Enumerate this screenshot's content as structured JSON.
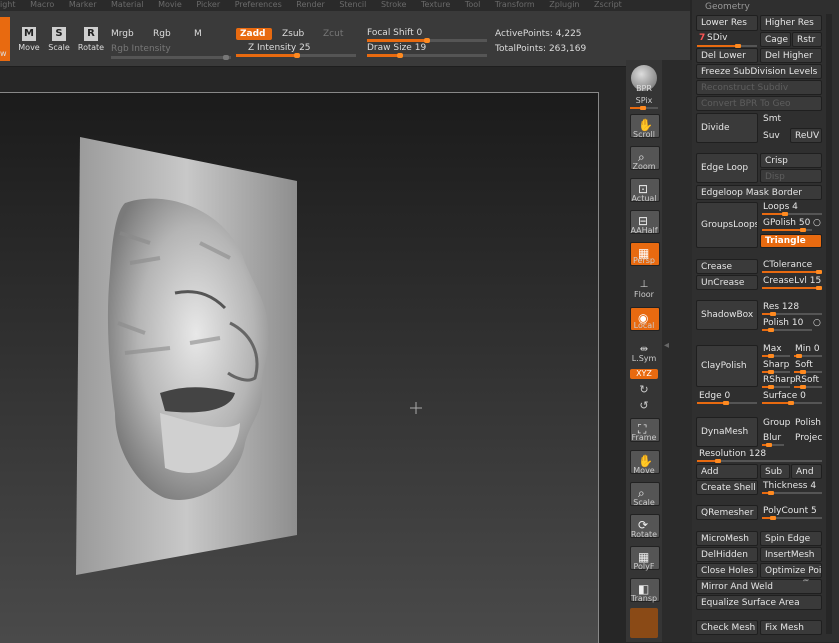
{
  "menu": [
    "ight",
    "Macro",
    "Marker",
    "Material",
    "Movie",
    "Picker",
    "Preferences",
    "Render",
    "Stencil",
    "Stroke",
    "Texture",
    "Tool",
    "Transform",
    "Zplugin",
    "Zscript"
  ],
  "transform_tools": [
    {
      "label": "w",
      "icon": "draw-icon",
      "active": true
    },
    {
      "label": "Move",
      "icon": "M",
      "active": false
    },
    {
      "label": "Scale",
      "icon": "S",
      "active": false
    },
    {
      "label": "Rotate",
      "icon": "R",
      "active": false
    }
  ],
  "topbar": {
    "mrgb": "Mrgb",
    "rgb": "Rgb",
    "m": "M",
    "rgb_intensity": "Rgb Intensity",
    "zadd": "Zadd",
    "zsub": "Zsub",
    "zcut": "Zcut",
    "z_intensity_label": "Z Intensity",
    "z_intensity_value": "25",
    "focal_shift_label": "Focal Shift",
    "focal_shift_value": "0",
    "draw_size_label": "Draw Size",
    "draw_size_value": "19",
    "active_points": "ActivePoints: 4,225",
    "total_points": "TotalPoints: 263,169"
  },
  "shelf": {
    "bpr": "BPR",
    "spix": "SPix",
    "scroll": "Scroll",
    "zoom": "Zoom",
    "actual": "Actual",
    "aahalf": "AAHalf",
    "persp": "Persp",
    "floor": "Floor",
    "local": "Local",
    "lsym": "L.Sym",
    "xyz": "XYZ",
    "frame": "Frame",
    "move": "Move",
    "scale": "Scale",
    "rotate": "Rotate",
    "polyf": "PolyF",
    "transp": "Transp"
  },
  "geometry": {
    "title": "Geometry",
    "lower_res": "Lower Res",
    "higher_res": "Higher Res",
    "sdiv_value": "7",
    "sdiv_label": "SDiv",
    "cage": "Cage",
    "rstr": "Rstr",
    "del_lower": "Del Lower",
    "del_higher": "Del Higher",
    "freeze": "Freeze SubDivision Levels",
    "reconstruct": "Reconstruct Subdiv",
    "convert_bpr": "Convert BPR To Geo",
    "divide": "Divide",
    "smt": "Smt",
    "suv": "Suv",
    "reuv": "ReUV",
    "edge_loop": "Edge Loop",
    "crisp": "Crisp",
    "disp": "Disp",
    "edgeloop_mask": "Edgeloop Mask Border",
    "groupsloops": "GroupsLoops",
    "loops": "Loops 4",
    "gpolish": "GPolish 50",
    "triangle": "Triangle",
    "crease": "Crease",
    "ctolerance": "CTolerance",
    "uncrease": "UnCrease",
    "creaselvl": "CreaseLvl 15",
    "shadowbox": "ShadowBox",
    "res": "Res 128",
    "polish": "Polish 10",
    "claypolish": "ClayPolish",
    "max": "Max",
    "min": "Min 0",
    "sharp": "Sharp",
    "soft": "Soft",
    "rsharp": "RSharp",
    "rsoft": "RSoft",
    "edge": "Edge 0",
    "surface": "Surface 0",
    "dynamesh": "DynaMesh",
    "group": "Group",
    "polish2": "Polish",
    "blur": "Blur",
    "project": "Projec",
    "resolution": "Resolution 128",
    "add": "Add",
    "sub": "Sub",
    "and": "And",
    "create_shell": "Create Shell",
    "thickness": "Thickness 4",
    "qremesher": "QRemesher",
    "polycount": "PolyCount 5",
    "micromesh": "MicroMesh",
    "spin_edge": "Spin Edge",
    "delhidden": "DelHidden",
    "insertmesh": "InsertMesh",
    "close_holes": "Close Holes",
    "optimize": "Optimize Poi",
    "mirror_weld": "Mirror And Weld",
    "equalize": "Equalize Surface Area",
    "check_mesh": "Check Mesh",
    "fix_mesh": "Fix Mesh"
  },
  "colors": {
    "accent": "#e86a10",
    "panel": "#2f2f2f",
    "button": "#3a3a3a"
  }
}
